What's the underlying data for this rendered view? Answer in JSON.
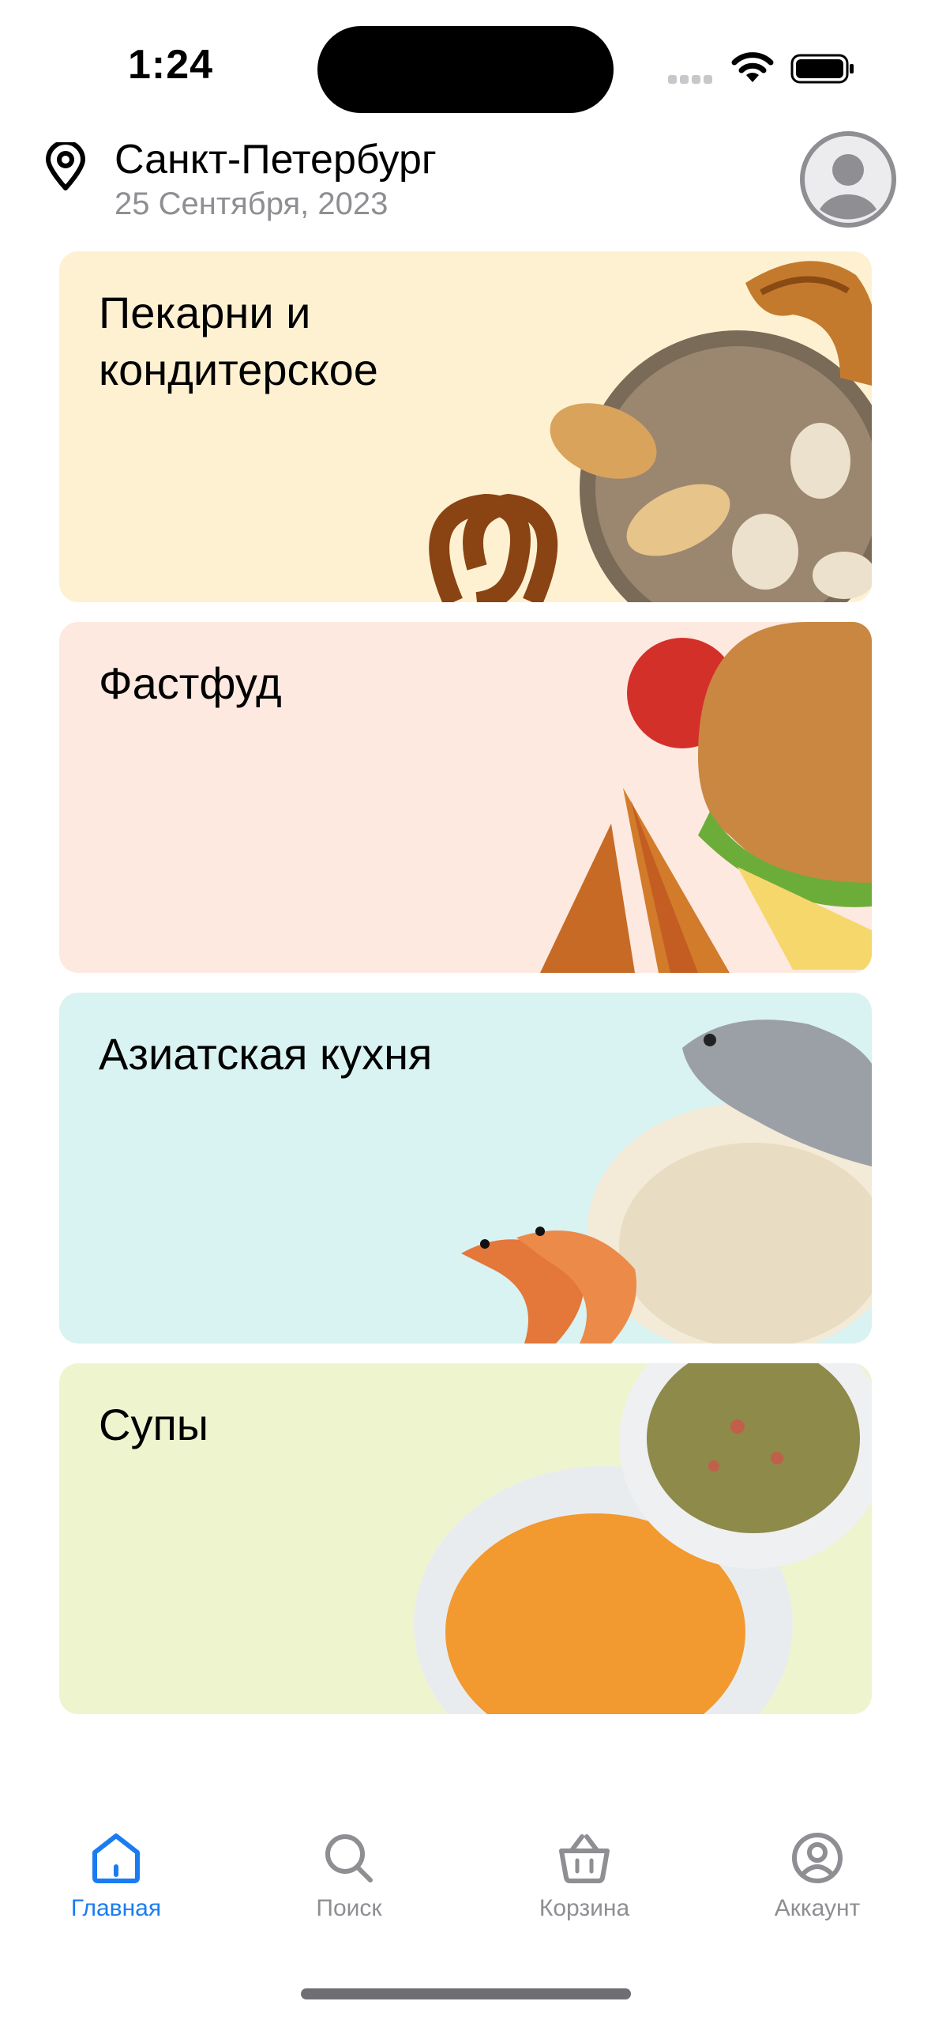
{
  "status_bar": {
    "time": "1:24"
  },
  "header": {
    "city": "Санкт-Петербург",
    "date": "25 Сентября, 2023"
  },
  "categories": [
    {
      "title": "Пекарни и кондитерское",
      "bg": "#FEF1D2"
    },
    {
      "title": "Фастфуд",
      "bg": "#FDE9E0"
    },
    {
      "title": "Азиатская кухня",
      "bg": "#D9F2F2"
    },
    {
      "title": "Супы",
      "bg": "#EEF5CE"
    }
  ],
  "tabbar": {
    "active_color": "#1A7CF0",
    "inactive_color": "#8E8E93",
    "items": [
      {
        "label": "Главная",
        "icon": "home-icon",
        "active": true
      },
      {
        "label": "Поиск",
        "icon": "search-icon",
        "active": false
      },
      {
        "label": "Корзина",
        "icon": "basket-icon",
        "active": false
      },
      {
        "label": "Аккаунт",
        "icon": "account-icon",
        "active": false
      }
    ]
  }
}
